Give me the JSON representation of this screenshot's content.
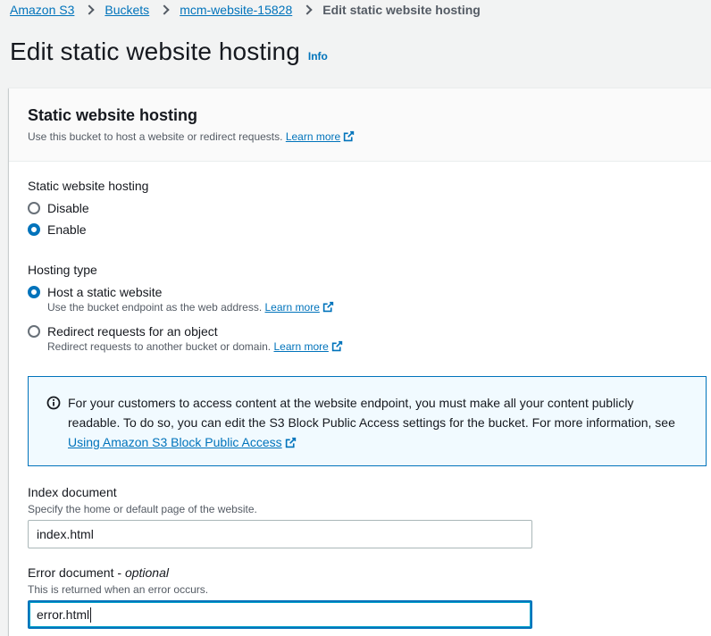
{
  "breadcrumb": {
    "items": [
      "Amazon S3",
      "Buckets",
      "mcm-website-15828"
    ],
    "current": "Edit static website hosting"
  },
  "page": {
    "title": "Edit static website hosting",
    "info": "Info"
  },
  "section": {
    "title": "Static website hosting",
    "description": "Use this bucket to host a website or redirect requests.",
    "learn_more": "Learn more"
  },
  "hosting": {
    "label": "Static website hosting",
    "options": [
      {
        "label": "Disable",
        "checked": false
      },
      {
        "label": "Enable",
        "checked": true
      }
    ]
  },
  "hosting_type": {
    "label": "Hosting type",
    "options": [
      {
        "label": "Host a static website",
        "description": "Use the bucket endpoint as the web address.",
        "learn_more": "Learn more",
        "checked": true
      },
      {
        "label": "Redirect requests for an object",
        "description": "Redirect requests to another bucket or domain.",
        "learn_more": "Learn more",
        "checked": false
      }
    ]
  },
  "alert": {
    "text": "For your customers to access content at the website endpoint, you must make all your content publicly readable. To do so, you can edit the S3 Block Public Access settings for the bucket. For more information, see",
    "link": "Using Amazon S3 Block Public Access"
  },
  "index_document": {
    "label": "Index document",
    "hint": "Specify the home or default page of the website.",
    "value": "index.html"
  },
  "error_document": {
    "label": "Error document",
    "label_suffix": " - ",
    "optional": "optional",
    "hint": "This is returned when an error occurs.",
    "value": "error.html"
  },
  "colors": {
    "link": "#0073bb",
    "text": "#16191f",
    "muted": "#545b64",
    "alert_bg": "#f1faff",
    "page_bg": "#f2f3f3"
  }
}
